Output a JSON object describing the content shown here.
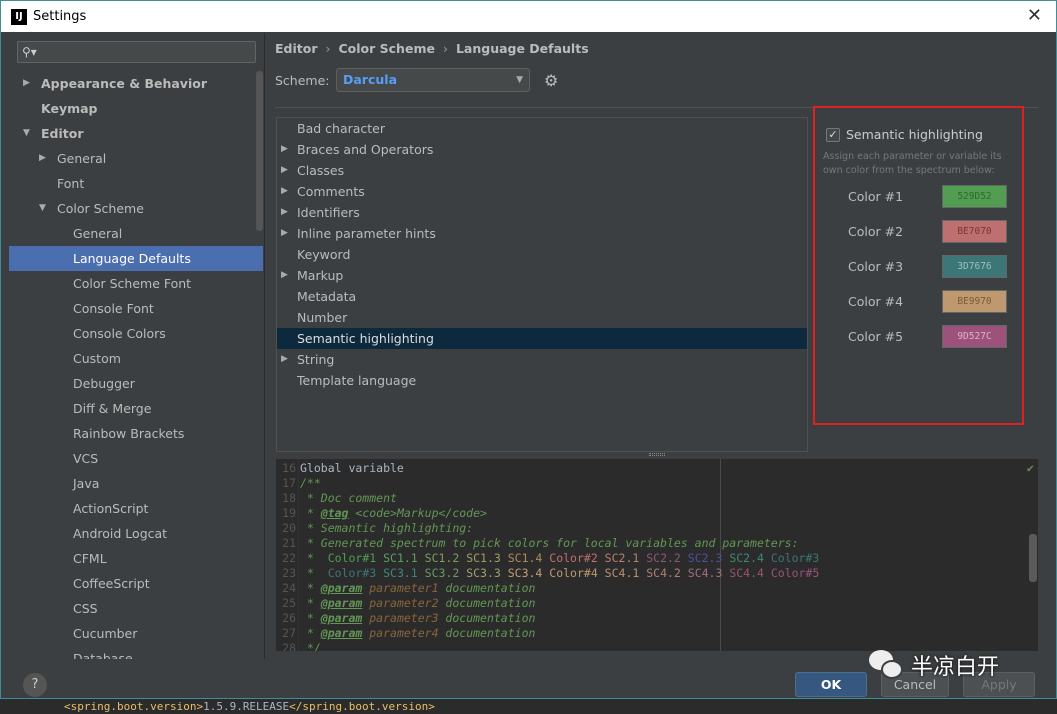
{
  "window": {
    "title": "Settings",
    "close": "✕"
  },
  "search": {
    "placeholder": "",
    "icon": "search-icon"
  },
  "sidebar": {
    "items": [
      {
        "label": "Appearance & Behavior",
        "level": 0,
        "arrow": "▶",
        "bold": true
      },
      {
        "label": "Keymap",
        "level": 0,
        "arrow": "",
        "bold": true
      },
      {
        "label": "Editor",
        "level": 0,
        "arrow": "▼",
        "bold": true
      },
      {
        "label": "General",
        "level": 1,
        "arrow": "▶"
      },
      {
        "label": "Font",
        "level": 1,
        "arrow": ""
      },
      {
        "label": "Color Scheme",
        "level": 1,
        "arrow": "▼"
      },
      {
        "label": "General",
        "level": 2,
        "arrow": ""
      },
      {
        "label": "Language Defaults",
        "level": 2,
        "arrow": "",
        "selected": true
      },
      {
        "label": "Color Scheme Font",
        "level": 2,
        "arrow": ""
      },
      {
        "label": "Console Font",
        "level": 2,
        "arrow": ""
      },
      {
        "label": "Console Colors",
        "level": 2,
        "arrow": ""
      },
      {
        "label": "Custom",
        "level": 2,
        "arrow": ""
      },
      {
        "label": "Debugger",
        "level": 2,
        "arrow": ""
      },
      {
        "label": "Diff & Merge",
        "level": 2,
        "arrow": ""
      },
      {
        "label": "Rainbow Brackets",
        "level": 2,
        "arrow": ""
      },
      {
        "label": "VCS",
        "level": 2,
        "arrow": ""
      },
      {
        "label": "Java",
        "level": 2,
        "arrow": ""
      },
      {
        "label": "ActionScript",
        "level": 2,
        "arrow": ""
      },
      {
        "label": "Android Logcat",
        "level": 2,
        "arrow": ""
      },
      {
        "label": "CFML",
        "level": 2,
        "arrow": ""
      },
      {
        "label": "CoffeeScript",
        "level": 2,
        "arrow": ""
      },
      {
        "label": "CSS",
        "level": 2,
        "arrow": ""
      },
      {
        "label": "Cucumber",
        "level": 2,
        "arrow": ""
      },
      {
        "label": "Database",
        "level": 2,
        "arrow": ""
      }
    ]
  },
  "breadcrumb": [
    "Editor",
    "Color Scheme",
    "Language Defaults"
  ],
  "breadcrumb_sep": "›",
  "scheme": {
    "label": "Scheme:",
    "value": "Darcula"
  },
  "list": {
    "items": [
      {
        "label": "Bad character",
        "arrow": ""
      },
      {
        "label": "Braces and Operators",
        "arrow": "▶"
      },
      {
        "label": "Classes",
        "arrow": "▶"
      },
      {
        "label": "Comments",
        "arrow": "▶"
      },
      {
        "label": "Identifiers",
        "arrow": "▶"
      },
      {
        "label": "Inline parameter hints",
        "arrow": "▶"
      },
      {
        "label": "Keyword",
        "arrow": ""
      },
      {
        "label": "Markup",
        "arrow": "▶"
      },
      {
        "label": "Metadata",
        "arrow": ""
      },
      {
        "label": "Number",
        "arrow": ""
      },
      {
        "label": "Semantic highlighting",
        "arrow": "",
        "selected": true
      },
      {
        "label": "String",
        "arrow": "▶"
      },
      {
        "label": "Template language",
        "arrow": ""
      }
    ]
  },
  "semantic": {
    "checkbox_label": "Semantic highlighting",
    "checked": true,
    "hint": "Assign each parameter or variable its own color from the spectrum below:",
    "colors": [
      {
        "label": "Color #1",
        "hex": "529D52",
        "swatch": "#529d52",
        "text": "#2d6a2d"
      },
      {
        "label": "Color #2",
        "hex": "BE7070",
        "swatch": "#be7070",
        "text": "#7a3535"
      },
      {
        "label": "Color #3",
        "hex": "3D7676",
        "swatch": "#3d7676",
        "text": "#9ac0c0"
      },
      {
        "label": "Color #4",
        "hex": "BE9970",
        "swatch": "#be9970",
        "text": "#7a5a35"
      },
      {
        "label": "Color #5",
        "hex": "9D527C",
        "swatch": "#9d527c",
        "text": "#e0b0cc"
      }
    ]
  },
  "editor": {
    "lines": [
      {
        "n": "16",
        "parts": [
          {
            "t": "Global variable",
            "c": "gv"
          }
        ]
      },
      {
        "n": "17",
        "parts": [
          {
            "t": "/**",
            "c": "cm"
          }
        ]
      },
      {
        "n": "18",
        "parts": [
          {
            "t": " * Doc comment",
            "c": "cm"
          }
        ]
      },
      {
        "n": "19",
        "parts": [
          {
            "t": " * ",
            "c": "cm"
          },
          {
            "t": "@tag",
            "c": "tag"
          },
          {
            "t": " <code>Markup</code>",
            "c": "cm"
          }
        ]
      },
      {
        "n": "20",
        "parts": [
          {
            "t": " * Semantic highlighting:",
            "c": "cm"
          }
        ]
      },
      {
        "n": "21",
        "parts": [
          {
            "t": " * Generated spectrum to pick colors for local variables and parameters:",
            "c": "cm"
          }
        ]
      },
      {
        "n": "22",
        "parts": [
          {
            "t": " *  ",
            "c": "cm"
          },
          {
            "t": "Color#1",
            "c": "c1"
          },
          {
            "t": " SC1.1",
            "c": "s11"
          },
          {
            "t": " SC1.2",
            "c": "s12"
          },
          {
            "t": " SC1.3",
            "c": "s13"
          },
          {
            "t": " SC1.4",
            "c": "s14"
          },
          {
            "t": " Color#2",
            "c": "c2"
          },
          {
            "t": " SC2.1",
            "c": "s21"
          },
          {
            "t": " SC2.2",
            "c": "s22"
          },
          {
            "t": " SC2.3",
            "c": "s23"
          },
          {
            "t": " SC2.4",
            "c": "s24"
          },
          {
            "t": " Color#3",
            "c": "c3"
          }
        ]
      },
      {
        "n": "23",
        "parts": [
          {
            "t": " *  ",
            "c": "cm"
          },
          {
            "t": "Color#3",
            "c": "c3"
          },
          {
            "t": " SC3.1",
            "c": "s31"
          },
          {
            "t": " SC3.2",
            "c": "s32"
          },
          {
            "t": " SC3.3",
            "c": "s33"
          },
          {
            "t": " SC3.4",
            "c": "s34"
          },
          {
            "t": " Color#4",
            "c": "c4"
          },
          {
            "t": " SC4.1",
            "c": "s41"
          },
          {
            "t": " SC4.2",
            "c": "s42"
          },
          {
            "t": " SC4.3",
            "c": "s43"
          },
          {
            "t": " SC4.4",
            "c": "s44"
          },
          {
            "t": " Color#5",
            "c": "c5"
          }
        ]
      },
      {
        "n": "24",
        "parts": [
          {
            "t": " * ",
            "c": "cm"
          },
          {
            "t": "@param",
            "c": "tag"
          },
          {
            "t": " parameter1",
            "c": "pm"
          },
          {
            "t": " documentation",
            "c": "cm"
          }
        ]
      },
      {
        "n": "25",
        "parts": [
          {
            "t": " * ",
            "c": "cm"
          },
          {
            "t": "@param",
            "c": "tag"
          },
          {
            "t": " parameter2",
            "c": "pm"
          },
          {
            "t": " documentation",
            "c": "cm"
          }
        ]
      },
      {
        "n": "26",
        "parts": [
          {
            "t": " * ",
            "c": "cm"
          },
          {
            "t": "@param",
            "c": "tag"
          },
          {
            "t": " parameter3",
            "c": "pm"
          },
          {
            "t": " documentation",
            "c": "cm"
          }
        ]
      },
      {
        "n": "27",
        "parts": [
          {
            "t": " * ",
            "c": "cm"
          },
          {
            "t": "@param",
            "c": "tag"
          },
          {
            "t": " parameter4",
            "c": "pm"
          },
          {
            "t": " documentation",
            "c": "cm"
          }
        ]
      },
      {
        "n": "28",
        "parts": [
          {
            "t": " */",
            "c": "cm"
          }
        ]
      }
    ]
  },
  "buttons": {
    "help": "?",
    "ok": "OK",
    "cancel": "Cancel",
    "apply": "Apply"
  },
  "watermark": "半凉白开",
  "background_code": {
    "open": "<spring.boot.version>",
    "value": "1.5.9.RELEASE",
    "close": "</spring.boot.version>"
  }
}
